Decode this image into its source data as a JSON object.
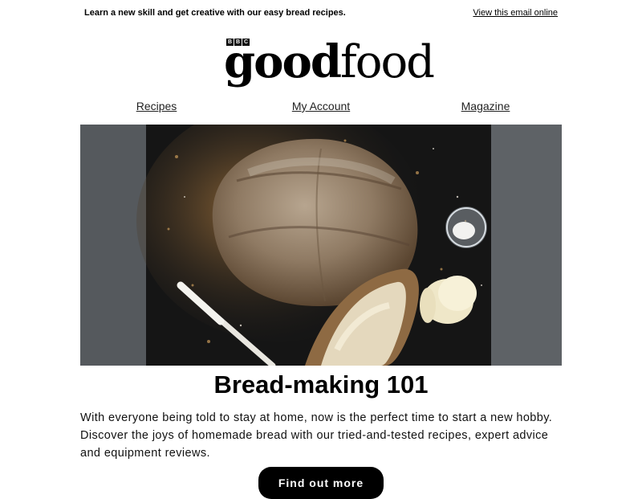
{
  "preheader": {
    "text": "Learn a new skill and get creative with our easy bread recipes.",
    "view_online": "View this email online"
  },
  "logo": {
    "bbc_letters": [
      "B",
      "B",
      "C"
    ],
    "word_good": "good",
    "word_food": "food"
  },
  "nav": {
    "items": [
      {
        "label": "Recipes"
      },
      {
        "label": "My Account"
      },
      {
        "label": "Magazine"
      }
    ]
  },
  "hero": {
    "icon": "bread-photo"
  },
  "article": {
    "headline": "Bread-making 101",
    "body": "With everyone being told to stay at home, now is the perfect time to start a new hobby. Discover the joys of homemade bread with our tried-and-tested recipes, expert advice and equipment reviews.",
    "cta_label": "Find out more"
  },
  "colors": {
    "background": "#ffffff",
    "text": "#000000",
    "cta_background": "#000000",
    "cta_text": "#ffffff"
  }
}
